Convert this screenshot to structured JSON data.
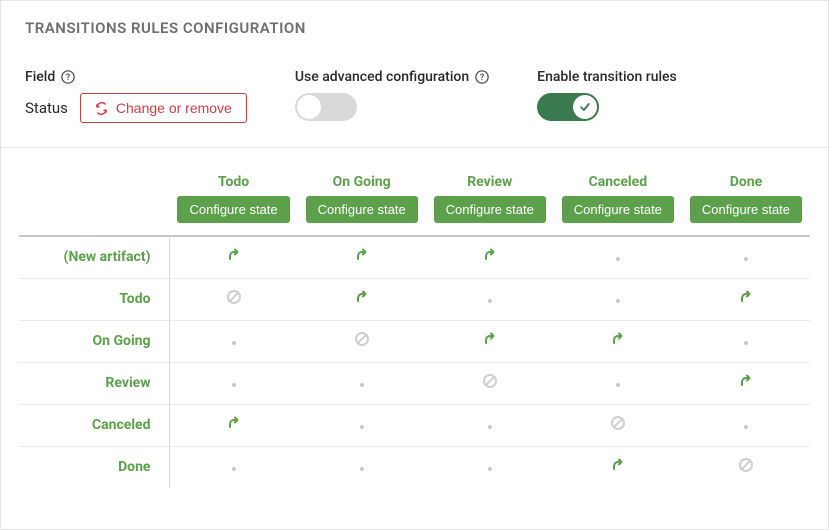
{
  "title": "TRANSITIONS RULES CONFIGURATION",
  "field": {
    "label": "Field",
    "value": "Status",
    "button": "Change or remove"
  },
  "advanced": {
    "label": "Use advanced configuration",
    "enabled": false
  },
  "enable": {
    "label": "Enable transition rules",
    "enabled": true
  },
  "configure_label": "Configure state",
  "states": [
    "Todo",
    "On Going",
    "Review",
    "Canceled",
    "Done"
  ],
  "rows": [
    {
      "name": "(New artifact)",
      "cells": [
        "arrow",
        "arrow",
        "arrow",
        "dot",
        "dot"
      ]
    },
    {
      "name": "Todo",
      "cells": [
        "forbid",
        "arrow",
        "dot",
        "dot",
        "arrow"
      ]
    },
    {
      "name": "On Going",
      "cells": [
        "dot",
        "forbid",
        "arrow",
        "arrow",
        "dot"
      ]
    },
    {
      "name": "Review",
      "cells": [
        "dot",
        "dot",
        "forbid",
        "dot",
        "arrow"
      ]
    },
    {
      "name": "Canceled",
      "cells": [
        "arrow",
        "dot",
        "dot",
        "forbid",
        "dot"
      ]
    },
    {
      "name": "Done",
      "cells": [
        "dot",
        "dot",
        "dot",
        "arrow",
        "forbid"
      ]
    }
  ]
}
